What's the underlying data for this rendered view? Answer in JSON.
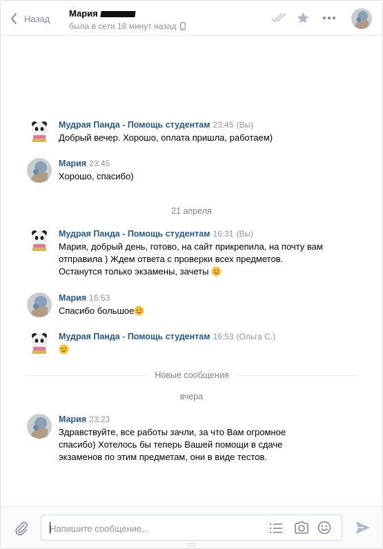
{
  "header": {
    "back_label": "Назад",
    "peer_name": "Мария",
    "peer_status": "была в сети 18 минут назад"
  },
  "messages": [
    {
      "author": "Мудрая Панда - Помощь студентам",
      "time": "23:45",
      "note": "(Вы)",
      "lines": [
        "Добрый вечер. Хорошо, оплата пришла, работаем)"
      ]
    },
    {
      "author": "Мария",
      "time": "23:45",
      "note": "",
      "lines": [
        "Хорошо, спасибо)"
      ]
    },
    {
      "author": "Мудрая Панда - Помощь студентам",
      "time": "16:31",
      "note": "(Вы)",
      "lines": [
        "Мария, добрый день, готово, на сайт прикрепила, на почту вам",
        "отправила ) Ждем ответа с проверки всех предметов.",
        "Останутся только экзамены, зачеты"
      ]
    },
    {
      "author": "Мария",
      "time": "16:53",
      "note": "",
      "lines": [
        "Спасибо большое"
      ]
    },
    {
      "author": "Мудрая Панда - Помощь студентам",
      "time": "16:53",
      "note": "(Ольга С.)",
      "lines": [
        ""
      ]
    },
    {
      "author": "Мария",
      "time": "23:23",
      "note": "",
      "lines": [
        "Здравствуйте, все работы зачли, за что Вам огромное",
        "спасибо) Хотелось бы теперь Вашей помощи в сдаче",
        "экзаменов по этим предметам, они в виде тестов."
      ]
    }
  ],
  "separators": {
    "date_1": "21 апреля",
    "new_messages": "Новые сообщения",
    "date_2": "вчера"
  },
  "composer": {
    "placeholder": "Напишите сообщение..."
  },
  "icons": {
    "back": "chevron-left-icon",
    "mobile": "mobile-phone-icon",
    "read": "double-check-icon",
    "star": "star-icon",
    "more": "more-dots-icon",
    "attach": "paperclip-icon",
    "templates": "list-icon",
    "camera": "camera-icon",
    "emoji": "smile-icon",
    "send": "send-arrow-icon"
  },
  "colors": {
    "author": "#2a5885",
    "muted": "#939393",
    "icon": "#828a99",
    "border": "#e7e8ec"
  }
}
